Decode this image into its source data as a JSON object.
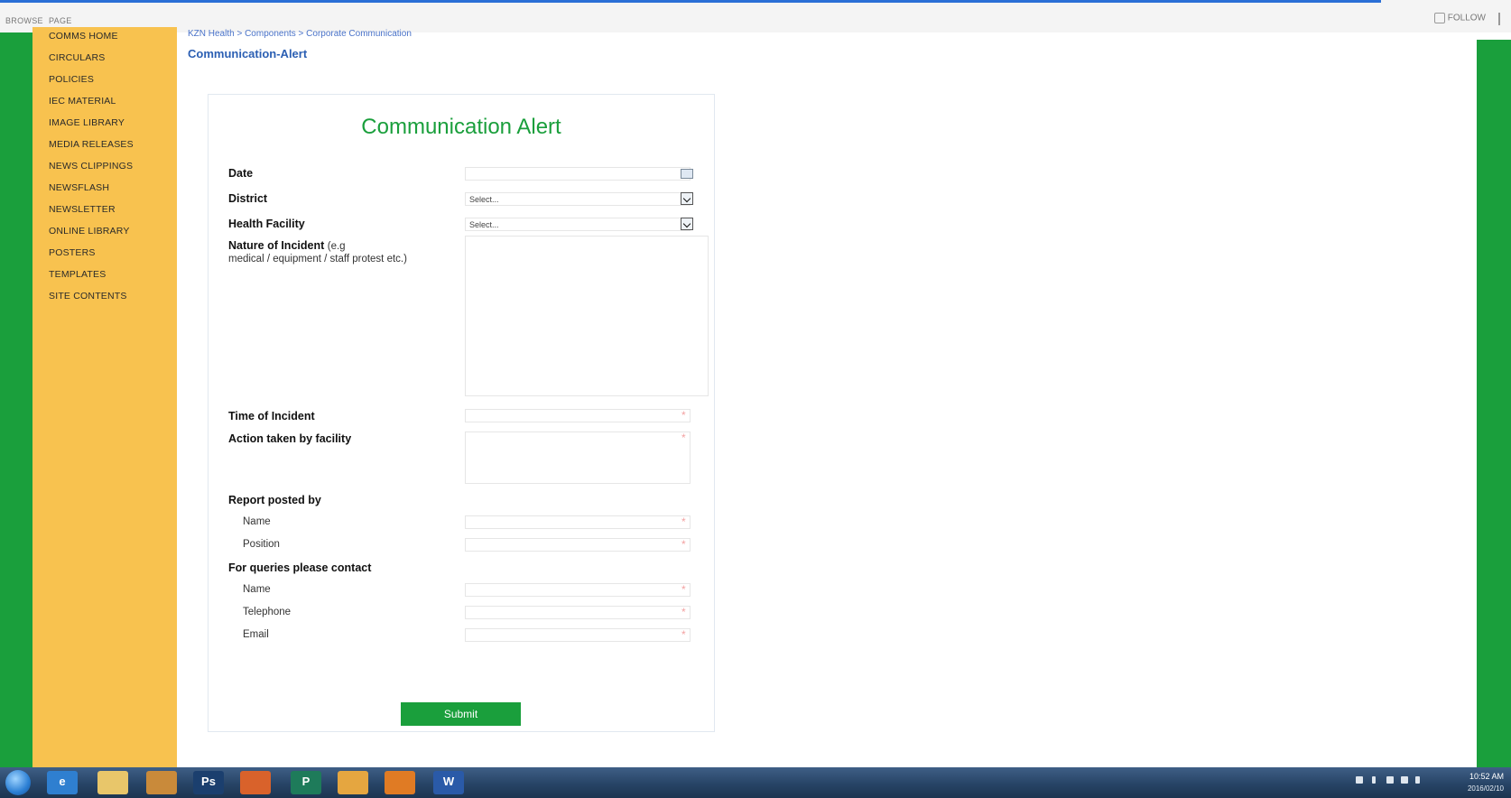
{
  "browser": {
    "tabs": [
      "BROWSE",
      "PAGE"
    ],
    "follow_label": "FOLLOW"
  },
  "sidebar": {
    "items": [
      {
        "label": "COMMS HOME"
      },
      {
        "label": "CIRCULARS"
      },
      {
        "label": "POLICIES"
      },
      {
        "label": "IEC MATERIAL"
      },
      {
        "label": "IMAGE LIBRARY"
      },
      {
        "label": "MEDIA RELEASES"
      },
      {
        "label": "NEWS CLIPPINGS"
      },
      {
        "label": "NEWSFLASH"
      },
      {
        "label": "NEWSLETTER"
      },
      {
        "label": "ONLINE LIBRARY"
      },
      {
        "label": "POSTERS"
      },
      {
        "label": "TEMPLATES"
      },
      {
        "label": "SITE CONTENTS"
      }
    ]
  },
  "breadcrumb": "KZN Health > Components > Corporate Communication",
  "page_title": "Communication-Alert",
  "form": {
    "title": "Communication Alert",
    "date_label": "Date",
    "district_label": "District",
    "district_value": "Select...",
    "facility_label": "Health Facility",
    "facility_value": "Select...",
    "nature_label": "Nature of Incident",
    "nature_hint_1": "(e.g",
    "nature_hint_2": "medical / equipment /  staff protest etc.)",
    "time_label": "Time of Incident",
    "action_label": "Action taken by facility",
    "report_heading": "Report posted by",
    "report_name_label": "Name",
    "report_position_label": "Position",
    "queries_heading": "For queries please contact",
    "queries_name_label": "Name",
    "queries_phone_label": "Telephone",
    "queries_email_label": "Email",
    "required_mark": "*",
    "submit_label": "Submit"
  },
  "taskbar": {
    "apps": [
      {
        "name": "ie",
        "glyph": "e",
        "color": "#2f7fd0"
      },
      {
        "name": "explorer",
        "glyph": "",
        "color": "#e8c66a"
      },
      {
        "name": "app3",
        "glyph": "",
        "color": "#c98a3a"
      },
      {
        "name": "photoshop",
        "glyph": "Ps",
        "color": "#1b3f6e"
      },
      {
        "name": "app5",
        "glyph": "",
        "color": "#d9622b"
      },
      {
        "name": "publisher",
        "glyph": "P",
        "color": "#1e7b5a"
      },
      {
        "name": "folder",
        "glyph": "",
        "color": "#e5a640"
      },
      {
        "name": "app8",
        "glyph": "",
        "color": "#e07b24"
      },
      {
        "name": "word",
        "glyph": "W",
        "color": "#2a5aa8"
      }
    ],
    "clock_time": "10:52 AM",
    "clock_date": "2016/02/10"
  },
  "colors": {
    "green": "#1a9f3c",
    "sidebar": "#f8c24f",
    "link": "#2b5fb3",
    "taskbar": "#274466"
  }
}
